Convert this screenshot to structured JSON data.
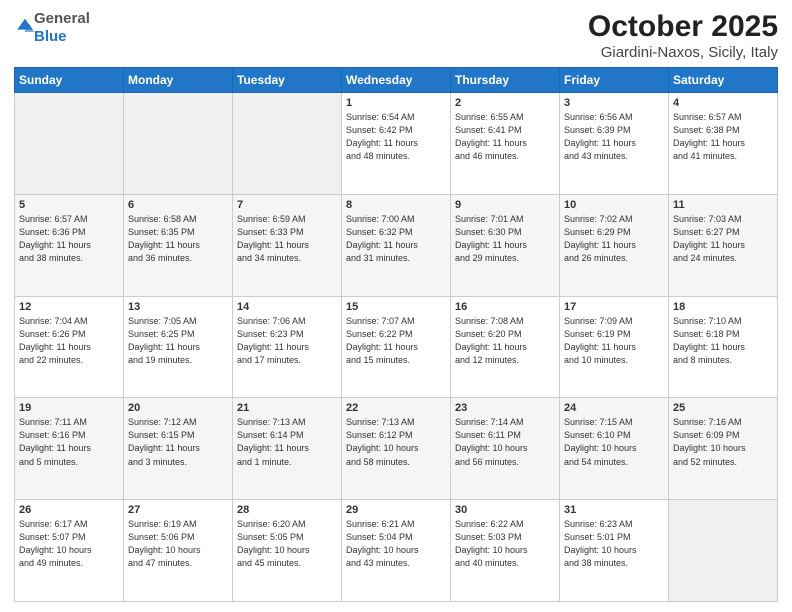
{
  "logo": {
    "general": "General",
    "blue": "Blue"
  },
  "title": "October 2025",
  "subtitle": "Giardini-Naxos, Sicily, Italy",
  "days_of_week": [
    "Sunday",
    "Monday",
    "Tuesday",
    "Wednesday",
    "Thursday",
    "Friday",
    "Saturday"
  ],
  "weeks": [
    [
      {
        "day": "",
        "info": ""
      },
      {
        "day": "",
        "info": ""
      },
      {
        "day": "",
        "info": ""
      },
      {
        "day": "1",
        "info": "Sunrise: 6:54 AM\nSunset: 6:42 PM\nDaylight: 11 hours\nand 48 minutes."
      },
      {
        "day": "2",
        "info": "Sunrise: 6:55 AM\nSunset: 6:41 PM\nDaylight: 11 hours\nand 46 minutes."
      },
      {
        "day": "3",
        "info": "Sunrise: 6:56 AM\nSunset: 6:39 PM\nDaylight: 11 hours\nand 43 minutes."
      },
      {
        "day": "4",
        "info": "Sunrise: 6:57 AM\nSunset: 6:38 PM\nDaylight: 11 hours\nand 41 minutes."
      }
    ],
    [
      {
        "day": "5",
        "info": "Sunrise: 6:57 AM\nSunset: 6:36 PM\nDaylight: 11 hours\nand 38 minutes."
      },
      {
        "day": "6",
        "info": "Sunrise: 6:58 AM\nSunset: 6:35 PM\nDaylight: 11 hours\nand 36 minutes."
      },
      {
        "day": "7",
        "info": "Sunrise: 6:59 AM\nSunset: 6:33 PM\nDaylight: 11 hours\nand 34 minutes."
      },
      {
        "day": "8",
        "info": "Sunrise: 7:00 AM\nSunset: 6:32 PM\nDaylight: 11 hours\nand 31 minutes."
      },
      {
        "day": "9",
        "info": "Sunrise: 7:01 AM\nSunset: 6:30 PM\nDaylight: 11 hours\nand 29 minutes."
      },
      {
        "day": "10",
        "info": "Sunrise: 7:02 AM\nSunset: 6:29 PM\nDaylight: 11 hours\nand 26 minutes."
      },
      {
        "day": "11",
        "info": "Sunrise: 7:03 AM\nSunset: 6:27 PM\nDaylight: 11 hours\nand 24 minutes."
      }
    ],
    [
      {
        "day": "12",
        "info": "Sunrise: 7:04 AM\nSunset: 6:26 PM\nDaylight: 11 hours\nand 22 minutes."
      },
      {
        "day": "13",
        "info": "Sunrise: 7:05 AM\nSunset: 6:25 PM\nDaylight: 11 hours\nand 19 minutes."
      },
      {
        "day": "14",
        "info": "Sunrise: 7:06 AM\nSunset: 6:23 PM\nDaylight: 11 hours\nand 17 minutes."
      },
      {
        "day": "15",
        "info": "Sunrise: 7:07 AM\nSunset: 6:22 PM\nDaylight: 11 hours\nand 15 minutes."
      },
      {
        "day": "16",
        "info": "Sunrise: 7:08 AM\nSunset: 6:20 PM\nDaylight: 11 hours\nand 12 minutes."
      },
      {
        "day": "17",
        "info": "Sunrise: 7:09 AM\nSunset: 6:19 PM\nDaylight: 11 hours\nand 10 minutes."
      },
      {
        "day": "18",
        "info": "Sunrise: 7:10 AM\nSunset: 6:18 PM\nDaylight: 11 hours\nand 8 minutes."
      }
    ],
    [
      {
        "day": "19",
        "info": "Sunrise: 7:11 AM\nSunset: 6:16 PM\nDaylight: 11 hours\nand 5 minutes."
      },
      {
        "day": "20",
        "info": "Sunrise: 7:12 AM\nSunset: 6:15 PM\nDaylight: 11 hours\nand 3 minutes."
      },
      {
        "day": "21",
        "info": "Sunrise: 7:13 AM\nSunset: 6:14 PM\nDaylight: 11 hours\nand 1 minute."
      },
      {
        "day": "22",
        "info": "Sunrise: 7:13 AM\nSunset: 6:12 PM\nDaylight: 10 hours\nand 58 minutes."
      },
      {
        "day": "23",
        "info": "Sunrise: 7:14 AM\nSunset: 6:11 PM\nDaylight: 10 hours\nand 56 minutes."
      },
      {
        "day": "24",
        "info": "Sunrise: 7:15 AM\nSunset: 6:10 PM\nDaylight: 10 hours\nand 54 minutes."
      },
      {
        "day": "25",
        "info": "Sunrise: 7:16 AM\nSunset: 6:09 PM\nDaylight: 10 hours\nand 52 minutes."
      }
    ],
    [
      {
        "day": "26",
        "info": "Sunrise: 6:17 AM\nSunset: 5:07 PM\nDaylight: 10 hours\nand 49 minutes."
      },
      {
        "day": "27",
        "info": "Sunrise: 6:19 AM\nSunset: 5:06 PM\nDaylight: 10 hours\nand 47 minutes."
      },
      {
        "day": "28",
        "info": "Sunrise: 6:20 AM\nSunset: 5:05 PM\nDaylight: 10 hours\nand 45 minutes."
      },
      {
        "day": "29",
        "info": "Sunrise: 6:21 AM\nSunset: 5:04 PM\nDaylight: 10 hours\nand 43 minutes."
      },
      {
        "day": "30",
        "info": "Sunrise: 6:22 AM\nSunset: 5:03 PM\nDaylight: 10 hours\nand 40 minutes."
      },
      {
        "day": "31",
        "info": "Sunrise: 6:23 AM\nSunset: 5:01 PM\nDaylight: 10 hours\nand 38 minutes."
      },
      {
        "day": "",
        "info": ""
      }
    ]
  ]
}
